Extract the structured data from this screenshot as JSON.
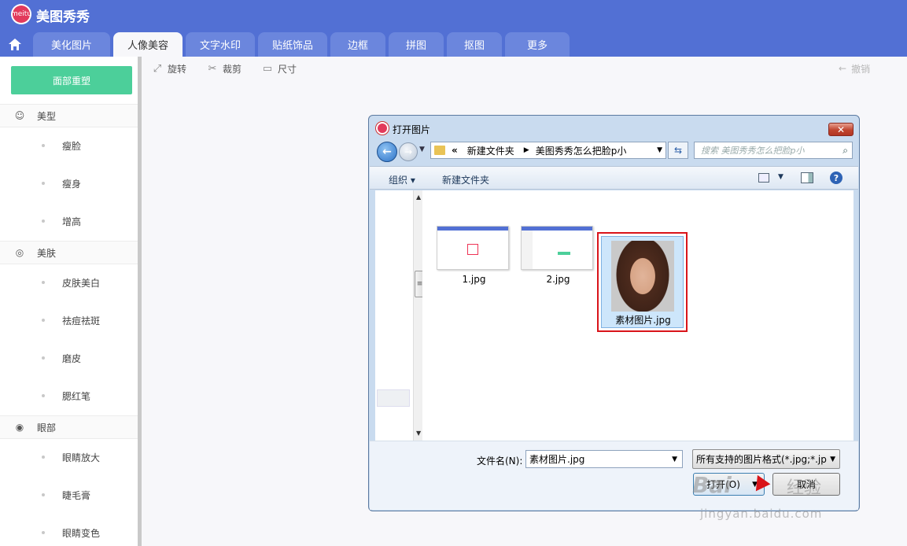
{
  "app": {
    "title": "美图秀秀",
    "logo_text": "meitu"
  },
  "tabs": [
    {
      "label": "美化图片"
    },
    {
      "label": "人像美容",
      "active": true
    },
    {
      "label": "文字水印"
    },
    {
      "label": "贴纸饰品"
    },
    {
      "label": "边框"
    },
    {
      "label": "拼图"
    },
    {
      "label": "抠图"
    },
    {
      "label": "更多"
    }
  ],
  "sidebar": {
    "reset_label": "面部重塑",
    "sections": [
      {
        "label": "美型",
        "icon": "face-icon",
        "items": [
          "瘦脸",
          "瘦身",
          "增高"
        ]
      },
      {
        "label": "美肤",
        "icon": "skin-icon",
        "items": [
          "皮肤美白",
          "祛痘祛斑",
          "磨皮",
          "腮红笔"
        ]
      },
      {
        "label": "眼部",
        "icon": "eye-icon",
        "items": [
          "眼睛放大",
          "睫毛膏",
          "眼睛变色"
        ]
      }
    ]
  },
  "toolbar": {
    "rotate": "旋转",
    "crop": "裁剪",
    "size": "尺寸",
    "undo": "撤销"
  },
  "dialog": {
    "title": "打开图片",
    "path": {
      "prefix": "«",
      "segment1": "新建文件夹",
      "segment2": "美图秀秀怎么把脸p小"
    },
    "search_placeholder": "搜索 美图秀秀怎么把脸p小",
    "organize": "组织 ▾",
    "new_folder": "新建文件夹",
    "files": [
      {
        "name": "1.jpg"
      },
      {
        "name": "2.jpg"
      },
      {
        "name": "素材图片.jpg",
        "selected": true
      }
    ],
    "filename_label": "文件名(N):",
    "filename_value": "素材图片.jpg",
    "filter_label": "所有支持的图片格式(*.jpg;*.jp",
    "open_button": "打开(O)",
    "cancel_button": "取消"
  },
  "watermark": {
    "brand": "Bai",
    "text": "经验",
    "url": "jingyan.baidu.com"
  },
  "colors": {
    "topbar": "#5270d4",
    "reset": "#4ccf9a",
    "highlight": "#d9141a"
  }
}
